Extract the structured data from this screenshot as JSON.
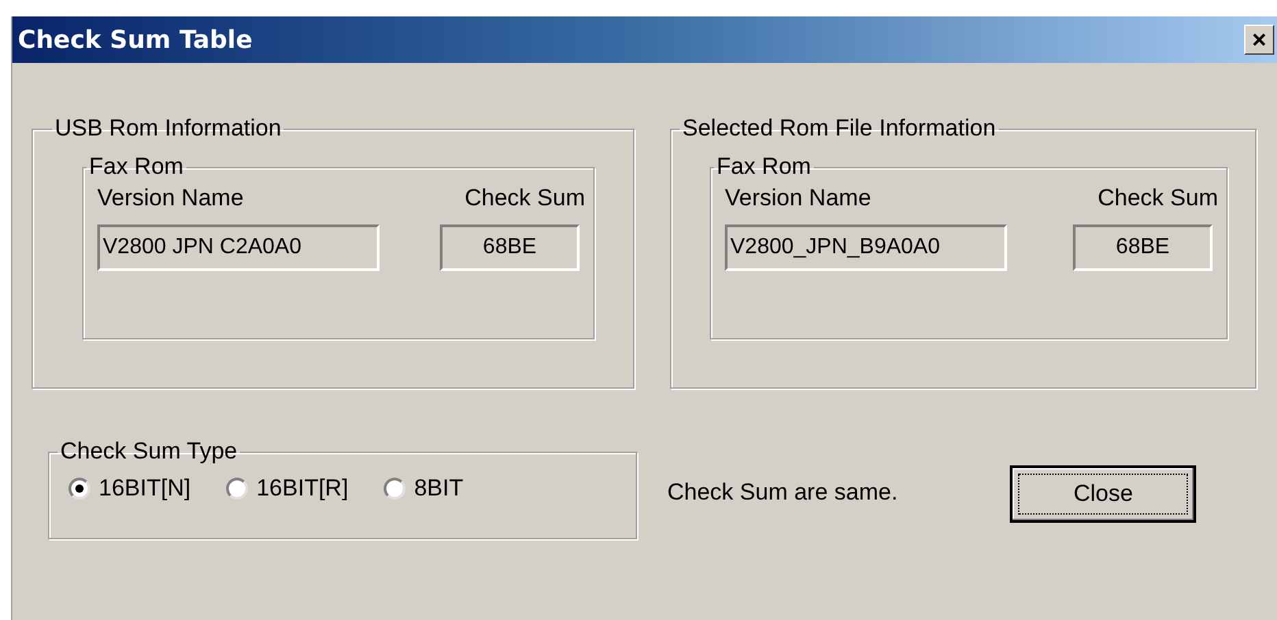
{
  "window": {
    "title": "Check Sum Table",
    "close": "×"
  },
  "panels": [
    {
      "title": "USB Rom Information",
      "group": "Fax Rom",
      "version_label": "Version Name",
      "checksum_label": "Check Sum",
      "version": "V2800 JPN C2A0A0",
      "checksum": "68BE"
    },
    {
      "title": "Selected Rom File Information",
      "group": "Fax Rom",
      "version_label": "Version Name",
      "checksum_label": "Check Sum",
      "version": "V2800_JPN_B9A0A0",
      "checksum": "68BE"
    }
  ],
  "checksum_type": {
    "title": "Check Sum Type",
    "options": [
      {
        "label": "16BIT[N]",
        "selected": true
      },
      {
        "label": "16BIT[R]",
        "selected": false
      },
      {
        "label": "8BIT",
        "selected": false
      }
    ]
  },
  "status": "Check Sum are same.",
  "close_button": "Close"
}
